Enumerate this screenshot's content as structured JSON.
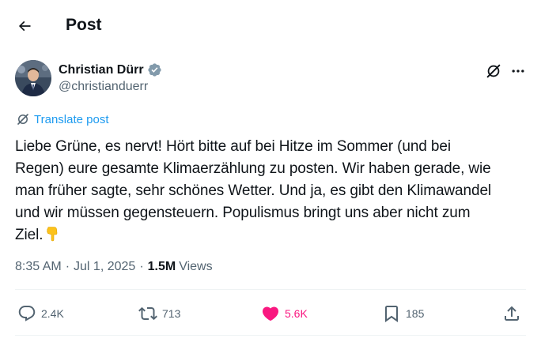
{
  "header": {
    "title": "Post",
    "back_icon": "arrow-left-icon"
  },
  "author": {
    "name": "Christian Dürr",
    "handle": "@christianduerr",
    "verified": true,
    "verified_color": "#829aab"
  },
  "translate": {
    "label": "Translate post",
    "icon": "grok-icon"
  },
  "tweet": {
    "lines": [
      "Liebe Grüne, es nervt! Hört bitte auf bei Hitze im Sommer (und bei",
      "Regen) eure gesamte Klimaerzählung zu posten. Wir haben gerade, wie",
      "man früher sagte, sehr schönes Wetter. Und ja, es gibt den Klimawandel",
      "und wir müssen gegensteuern. Populismus bringt uns aber nicht zum",
      "Ziel."
    ],
    "emoji": "backhand-index-pointing-down"
  },
  "meta": {
    "time": "8:35 AM",
    "separator": "·",
    "date": "Jul 1, 2025",
    "views_count": "1.5M",
    "views_label": "Views"
  },
  "actions": {
    "replies": "2.4K",
    "reposts": "713",
    "likes": "5.6K",
    "bookmarks": "185",
    "liked": true,
    "like_color": "#f91880"
  },
  "colors": {
    "text": "#0f1419",
    "secondary": "#536471",
    "accent": "#1d9bf0",
    "divider": "#eff3f4"
  }
}
